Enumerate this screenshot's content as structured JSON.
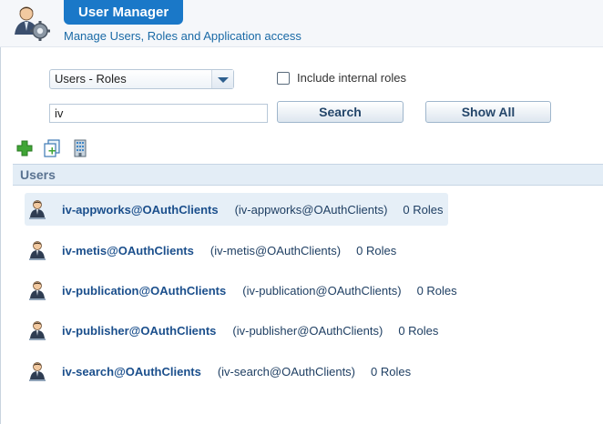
{
  "header": {
    "title": "User Manager",
    "subtitle": "Manage Users, Roles and Application access"
  },
  "filters": {
    "view_select": "Users - Roles",
    "include_internal_label": "Include internal roles",
    "include_internal_checked": false,
    "search_value": "iv",
    "search_button": "Search",
    "show_all_button": "Show All"
  },
  "toolbar": {
    "icons": [
      "add-icon",
      "copy-icon",
      "building-icon"
    ]
  },
  "users": {
    "heading": "Users",
    "rows": [
      {
        "name": "iv-appworks@OAuthClients",
        "desc": "(iv-appworks@OAuthClients)",
        "roles": "0 Roles",
        "selected": true
      },
      {
        "name": "iv-metis@OAuthClients",
        "desc": "(iv-metis@OAuthClients)",
        "roles": "0 Roles",
        "selected": false
      },
      {
        "name": "iv-publication@OAuthClients",
        "desc": "(iv-publication@OAuthClients)",
        "roles": "0 Roles",
        "selected": false
      },
      {
        "name": "iv-publisher@OAuthClients",
        "desc": "(iv-publisher@OAuthClients)",
        "roles": "0 Roles",
        "selected": false
      },
      {
        "name": "iv-search@OAuthClients",
        "desc": "(iv-search@OAuthClients)",
        "roles": "0 Roles",
        "selected": false
      }
    ]
  },
  "colors": {
    "accent": "#1a78c8",
    "section_bg": "#e3edf6",
    "selected_row": "#e6eff7"
  }
}
